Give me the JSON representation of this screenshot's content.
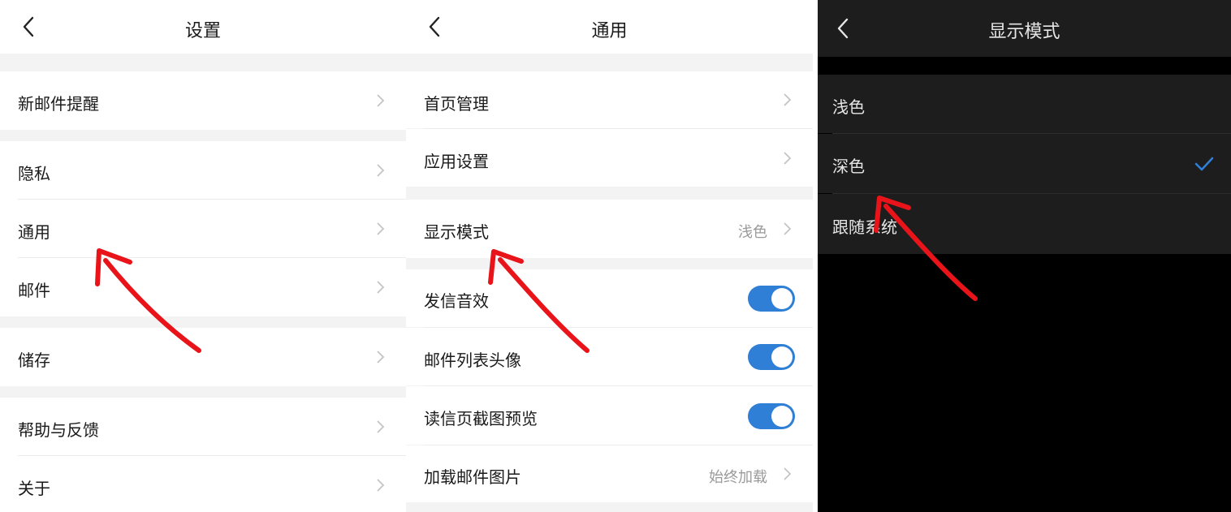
{
  "screen1": {
    "title": "设置",
    "items": [
      {
        "label": "新邮件提醒"
      },
      {
        "label": "隐私"
      },
      {
        "label": "通用"
      },
      {
        "label": "邮件"
      },
      {
        "label": "储存"
      },
      {
        "label": "帮助与反馈"
      },
      {
        "label": "关于"
      }
    ]
  },
  "screen2": {
    "title": "通用",
    "items": [
      {
        "label": "首页管理"
      },
      {
        "label": "应用设置"
      },
      {
        "label": "显示模式",
        "value": "浅色"
      },
      {
        "label": "发信音效",
        "toggle": true
      },
      {
        "label": "邮件列表头像",
        "toggle": true
      },
      {
        "label": "读信页截图预览",
        "toggle": true
      },
      {
        "label": "加载邮件图片",
        "value": "始终加载"
      }
    ]
  },
  "screen3": {
    "title": "显示模式",
    "options": [
      {
        "label": "浅色",
        "selected": false
      },
      {
        "label": "深色",
        "selected": true
      },
      {
        "label": "跟随系统",
        "selected": false
      }
    ]
  },
  "colors": {
    "accent": "#2f7fd6",
    "annotation_arrow": "#e8141a",
    "dark_surface": "#1d1d1d",
    "light_background": "#f3f3f3"
  },
  "icons": [
    "back-chevron-icon",
    "chevron-right-icon",
    "checkmark-icon",
    "annotation-arrow"
  ]
}
